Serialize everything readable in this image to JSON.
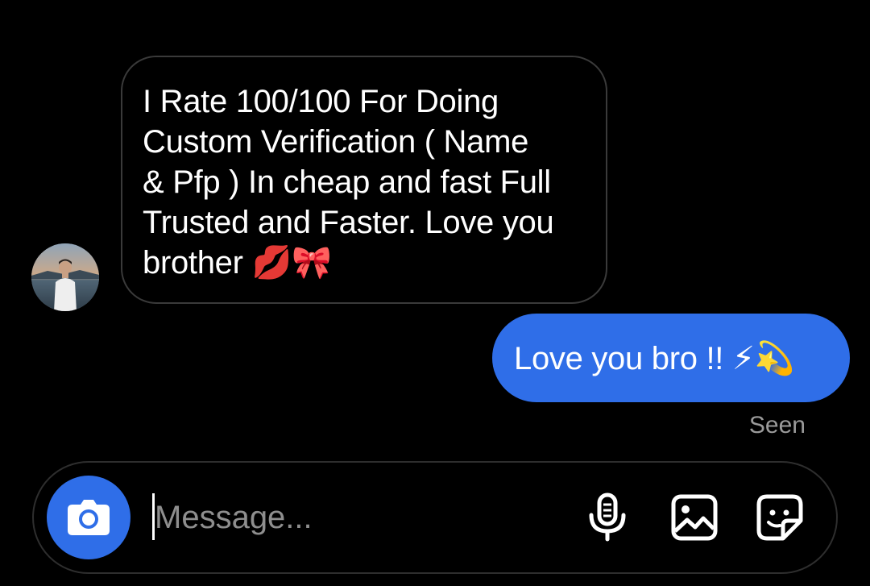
{
  "thread": {
    "incoming": {
      "avatar_icon": "user-avatar-photo",
      "text_lines": [
        "I Rate 100/100 For Doing",
        "Custom Verification ( Name",
        "& Pfp ) In cheap and fast Full",
        "Trusted and Faster. Love you",
        "brother 💋🎀"
      ]
    },
    "outgoing": {
      "text": "Love you bro !! ⚡💫",
      "bubble_color": "#2f6ee8"
    },
    "status": "Seen"
  },
  "composer": {
    "placeholder": "Message...",
    "value": "",
    "icons": {
      "camera": "camera-icon",
      "mic": "microphone-icon",
      "gallery": "image-gallery-icon",
      "sticker": "sticker-icon"
    }
  },
  "colors": {
    "background": "#000000",
    "accent": "#2f6ee8",
    "muted_text": "#9a9a9a",
    "border": "#3a3a3a"
  }
}
